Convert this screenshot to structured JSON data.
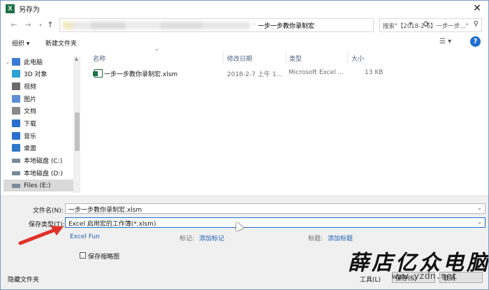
{
  "window": {
    "title": "另存为",
    "app_icon": "X"
  },
  "address": {
    "path": "一步一步教你录制宏",
    "crumb_sep": "›",
    "search_placeholder": "搜索\"【2018-2-6】一步一步...\""
  },
  "toolbar": {
    "organize": "组织 ▾",
    "new_folder": "新建文件夹"
  },
  "nav_items": [
    {
      "label": "此电脑",
      "icon": "pc-icon",
      "color": "#3a7bd5"
    },
    {
      "label": "3D 对象",
      "icon": "cube-icon",
      "color": "#2aa2d6"
    },
    {
      "label": "视频",
      "icon": "video-icon",
      "color": "#6b6b6b"
    },
    {
      "label": "图片",
      "icon": "picture-icon",
      "color": "#5b8fd6"
    },
    {
      "label": "文档",
      "icon": "document-icon",
      "color": "#8a8a8a"
    },
    {
      "label": "下载",
      "icon": "download-icon",
      "color": "#2a6fd0"
    },
    {
      "label": "音乐",
      "icon": "music-icon",
      "color": "#2a6fd0"
    },
    {
      "label": "桌面",
      "icon": "desktop-icon",
      "color": "#2e77c9"
    },
    {
      "label": "本地磁盘 (C:)",
      "icon": "drive-icon",
      "color": "#7a8a9a"
    },
    {
      "label": "本地磁盘 (D:)",
      "icon": "drive-icon",
      "color": "#7a8a9a"
    },
    {
      "label": "Files (E:)",
      "icon": "drive-icon",
      "color": "#7a8a9a"
    }
  ],
  "columns": {
    "name": "名称",
    "date": "修改日期",
    "type": "类型",
    "size": "大小"
  },
  "files": [
    {
      "name": "一步一步教你录制宏.xlsm",
      "date": "2018-2-7 上午 1...",
      "type": "Microsoft Excel ...",
      "size": "13 KB"
    }
  ],
  "form": {
    "filename_label": "文件名(N):",
    "filename_value": "一步一步教你录制宏.xlsm",
    "filetype_label": "保存类型(T):",
    "filetype_value": "Excel 启用宏的工作簿(*.xlsm)",
    "author": "Excel Fun",
    "tags_label": "标记:",
    "tags_link": "添加标记",
    "title_label": "标题:",
    "title_link": "添加标题",
    "thumbnail_label": "保存缩略图",
    "hide_folders": "隐藏文件夹",
    "tools": "工具(L)",
    "save": "保存(S)",
    "cancel": "取消"
  },
  "watermark": {
    "text": "薛店亿众电脑",
    "url": "www.yzdn.net"
  },
  "colors": {
    "excel_green": "#1e7145",
    "link_blue": "#1f5fb7",
    "arrow_red": "#e0322b"
  }
}
